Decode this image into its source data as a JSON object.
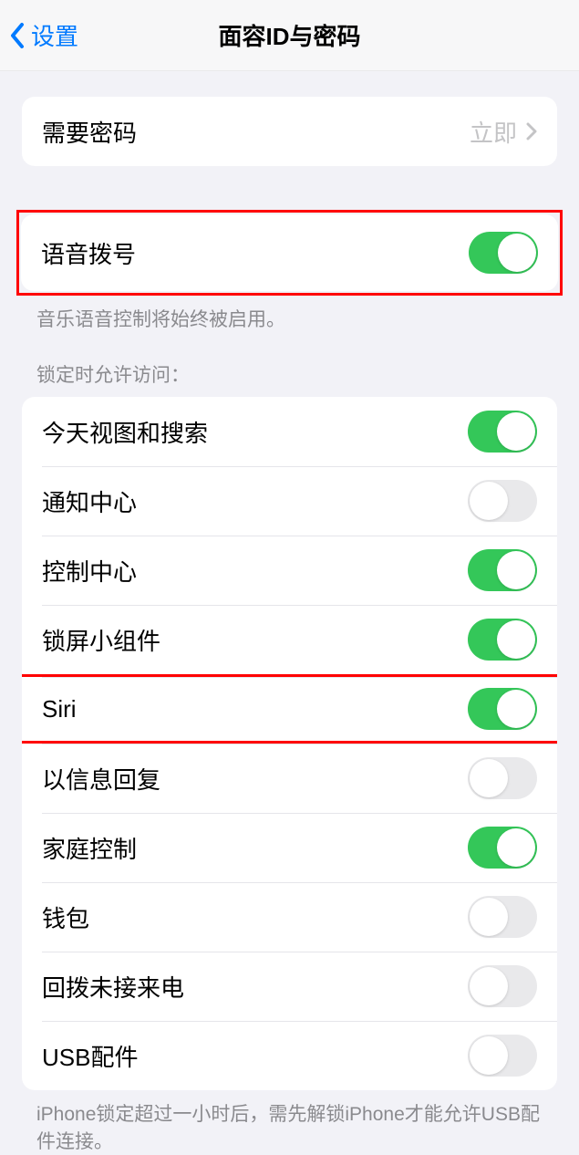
{
  "nav": {
    "back": "设置",
    "title": "面容ID与密码"
  },
  "passcode_row": {
    "label": "需要密码",
    "value": "立即"
  },
  "voice_dial": {
    "label": "语音拨号",
    "footer": "音乐语音控制将始终被启用。"
  },
  "lock_access": {
    "header": "锁定时允许访问：",
    "items": [
      {
        "label": "今天视图和搜索",
        "on": true
      },
      {
        "label": "通知中心",
        "on": false
      },
      {
        "label": "控制中心",
        "on": true
      },
      {
        "label": "锁屏小组件",
        "on": true
      },
      {
        "label": "Siri",
        "on": true
      },
      {
        "label": "以信息回复",
        "on": false
      },
      {
        "label": "家庭控制",
        "on": true
      },
      {
        "label": "钱包",
        "on": false
      },
      {
        "label": "回拨未接来电",
        "on": false
      },
      {
        "label": "USB配件",
        "on": false
      }
    ],
    "footer": "iPhone锁定超过一小时后，需先解锁iPhone才能允许USB配件连接。"
  }
}
